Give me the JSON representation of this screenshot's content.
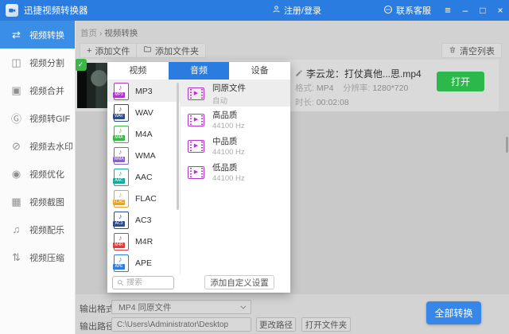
{
  "titlebar": {
    "app_title": "迅捷视频转换器",
    "app_icon": "app-logo-icon",
    "login_label": "注册/登录",
    "login_icon": "person-icon",
    "support_label": "联系客服",
    "support_icon": "chat-bubble-icon",
    "window_icons": [
      "menu-icon",
      "minimize-icon",
      "maximize-icon",
      "close-icon"
    ]
  },
  "sidebar": {
    "items": [
      {
        "label": "视频转换",
        "icon": "video-convert-icon",
        "active": true
      },
      {
        "label": "视频分割",
        "icon": "video-split-icon"
      },
      {
        "label": "视频合并",
        "icon": "video-merge-icon"
      },
      {
        "label": "视频转GIF",
        "icon": "video-to-gif-icon"
      },
      {
        "label": "视频去水印",
        "icon": "video-remove-watermark-icon"
      },
      {
        "label": "视频优化",
        "icon": "video-optimize-icon"
      },
      {
        "label": "视频截图",
        "icon": "video-screenshot-icon"
      },
      {
        "label": "视频配乐",
        "icon": "video-music-icon"
      },
      {
        "label": "视频压缩",
        "icon": "video-compress-icon"
      }
    ]
  },
  "breadcrumb": {
    "home": "首页",
    "separator": "›",
    "current": "视频转换"
  },
  "toolbar": {
    "add_file": "添加文件",
    "add_file_icon": "plus-icon",
    "add_folder": "添加文件夹",
    "add_folder_icon": "folder-icon",
    "clear_list": "清空列表",
    "clear_list_icon": "trash-icon"
  },
  "file_row": {
    "status_icon": "check-badge-icon",
    "name": "李云龙：打仗真他...思.mp4",
    "edit_icon": "pencil-icon",
    "format_label": "格式:",
    "format_value": "MP4",
    "resolution_label": "分辨率:",
    "resolution_value": "1280*720",
    "duration_label": "时长:",
    "duration_value": "00:02:08",
    "open_button": "打开"
  },
  "format_popup": {
    "tabs": [
      {
        "label": "视频"
      },
      {
        "label": "音频",
        "active": true
      },
      {
        "label": "设备"
      }
    ],
    "formats": [
      {
        "name": "MP3",
        "color": "#b136c8",
        "selected": true
      },
      {
        "name": "WAV",
        "color": "#2b4d8e"
      },
      {
        "name": "M4A",
        "color": "#3cb54a"
      },
      {
        "name": "WMA",
        "color": "#8a5fd3"
      },
      {
        "name": "AAC",
        "color": "#19a89c"
      },
      {
        "name": "FLAC",
        "color": "#f0a21f"
      },
      {
        "name": "AC3",
        "color": "#2b4d8e"
      },
      {
        "name": "M4R",
        "color": "#e03c3c"
      },
      {
        "name": "APE",
        "color": "#2f7de0"
      }
    ],
    "search_placeholder": "搜索",
    "search_icon": "search-icon",
    "quality_icon": "film-strip-icon",
    "qualities": [
      {
        "title": "同原文件",
        "subtitle": "自动",
        "selected": true
      },
      {
        "title": "高品质",
        "subtitle": "44100 Hz"
      },
      {
        "title": "中品质",
        "subtitle": "44100 Hz"
      },
      {
        "title": "低品质",
        "subtitle": "44100 Hz"
      }
    ],
    "custom_button": "添加自定义设置"
  },
  "output": {
    "format_label": "输出格式:",
    "format_value": "MP4 同原文件",
    "format_dropdown_icon": "chevron-down-icon",
    "path_label": "输出路径:",
    "path_value": "C:\\Users\\Administrator\\Desktop",
    "change_path_button": "更改路径",
    "open_folder_button": "打开文件夹",
    "convert_all_button": "全部转换"
  },
  "colors": {
    "titlebar_blue": "#2a7ce0",
    "sidebar_active_blue": "#3a8ee6",
    "tab_active_blue": "#2b7ce0",
    "open_button_green": "#2db84b",
    "convert_button_blue": "#3787e8",
    "quality_icon_purple": "#b136c8"
  }
}
